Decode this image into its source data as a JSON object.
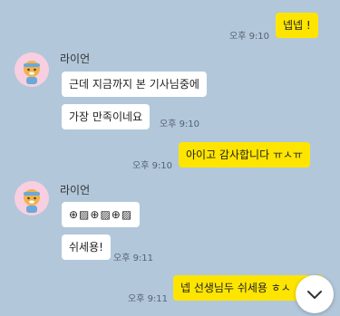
{
  "colors": {
    "background": "#b2c7da",
    "my_bubble": "#fee500",
    "other_bubble": "#ffffff",
    "avatar_bg": "#f7cfe0"
  },
  "messages": [
    {
      "from": "me",
      "text": "넵넵 !",
      "time": "오후 9:10"
    },
    {
      "from": "other",
      "sender": "라이언",
      "text": "근데 지금까지 본 기사님중에"
    },
    {
      "from": "other",
      "text": "가장 만족이네요",
      "time": "오후 9:10"
    },
    {
      "from": "me",
      "text": "아이고 감사합니다 ㅠㅅㅠ",
      "time": "오후 9:10"
    },
    {
      "from": "other",
      "sender": "라이언",
      "text": "🙇▨🙇▨🙇▨",
      "emoji_render": "⊕▨⊕▨⊕▨"
    },
    {
      "from": "other",
      "text": "쉬세용!",
      "time": "오후 9:11"
    },
    {
      "from": "me",
      "text": "넵 선생님두 쉬세용 ㅎㅅ",
      "time": "오후 9:11"
    }
  ],
  "scroll_button_icon": "chevron-down-icon"
}
